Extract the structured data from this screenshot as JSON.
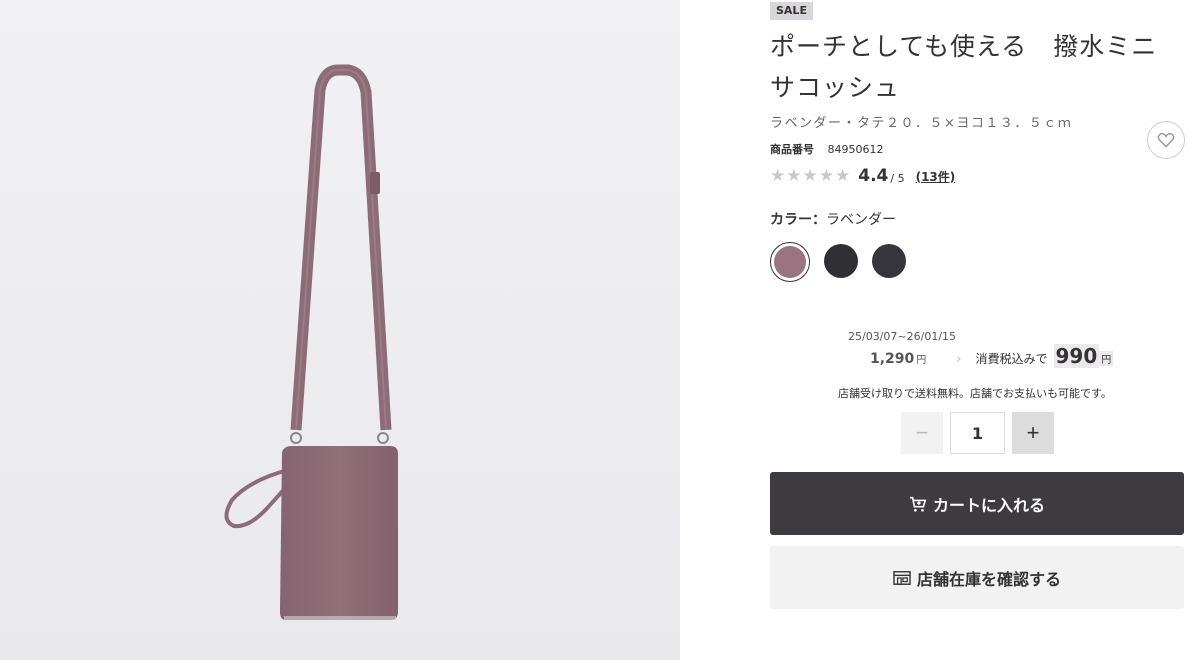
{
  "product": {
    "sale_badge": "SALE",
    "title": "ポーチとしても使える　撥水ミニサコッシュ",
    "variant": "ラベンダー・タテ２０．５×ヨコ１３．５ｃｍ",
    "code_label": "商品番号",
    "code": "84950612"
  },
  "rating": {
    "score": "4.4",
    "max": "/ 5",
    "count": "(13件)",
    "stars_value": 4.4
  },
  "color": {
    "label": "カラー：",
    "selected": "ラベンダー",
    "swatches": [
      {
        "name": "ラベンダー",
        "hex": "#9a7480",
        "selected": true
      },
      {
        "name": "",
        "hex": "#2f2f34",
        "selected": false
      },
      {
        "name": "",
        "hex": "#35353b",
        "selected": false
      }
    ]
  },
  "price": {
    "period": "25/03/07~26/01/15",
    "old_price": "1,290",
    "old_unit": "円",
    "tax_label": "消費税込みで",
    "new_price": "990",
    "new_unit": "円"
  },
  "pickup_note": "店舗受け取りで送料無料。店舗でお支払いも可能です。",
  "quantity": {
    "value": "1",
    "minus": "−",
    "plus": "+"
  },
  "buttons": {
    "cart": "カートに入れる",
    "stock": "店舗在庫を確認する"
  },
  "colors": {
    "bag": "#8f6b77",
    "primary_button": "#3d3b40",
    "secondary_button": "#f2f2f2"
  }
}
